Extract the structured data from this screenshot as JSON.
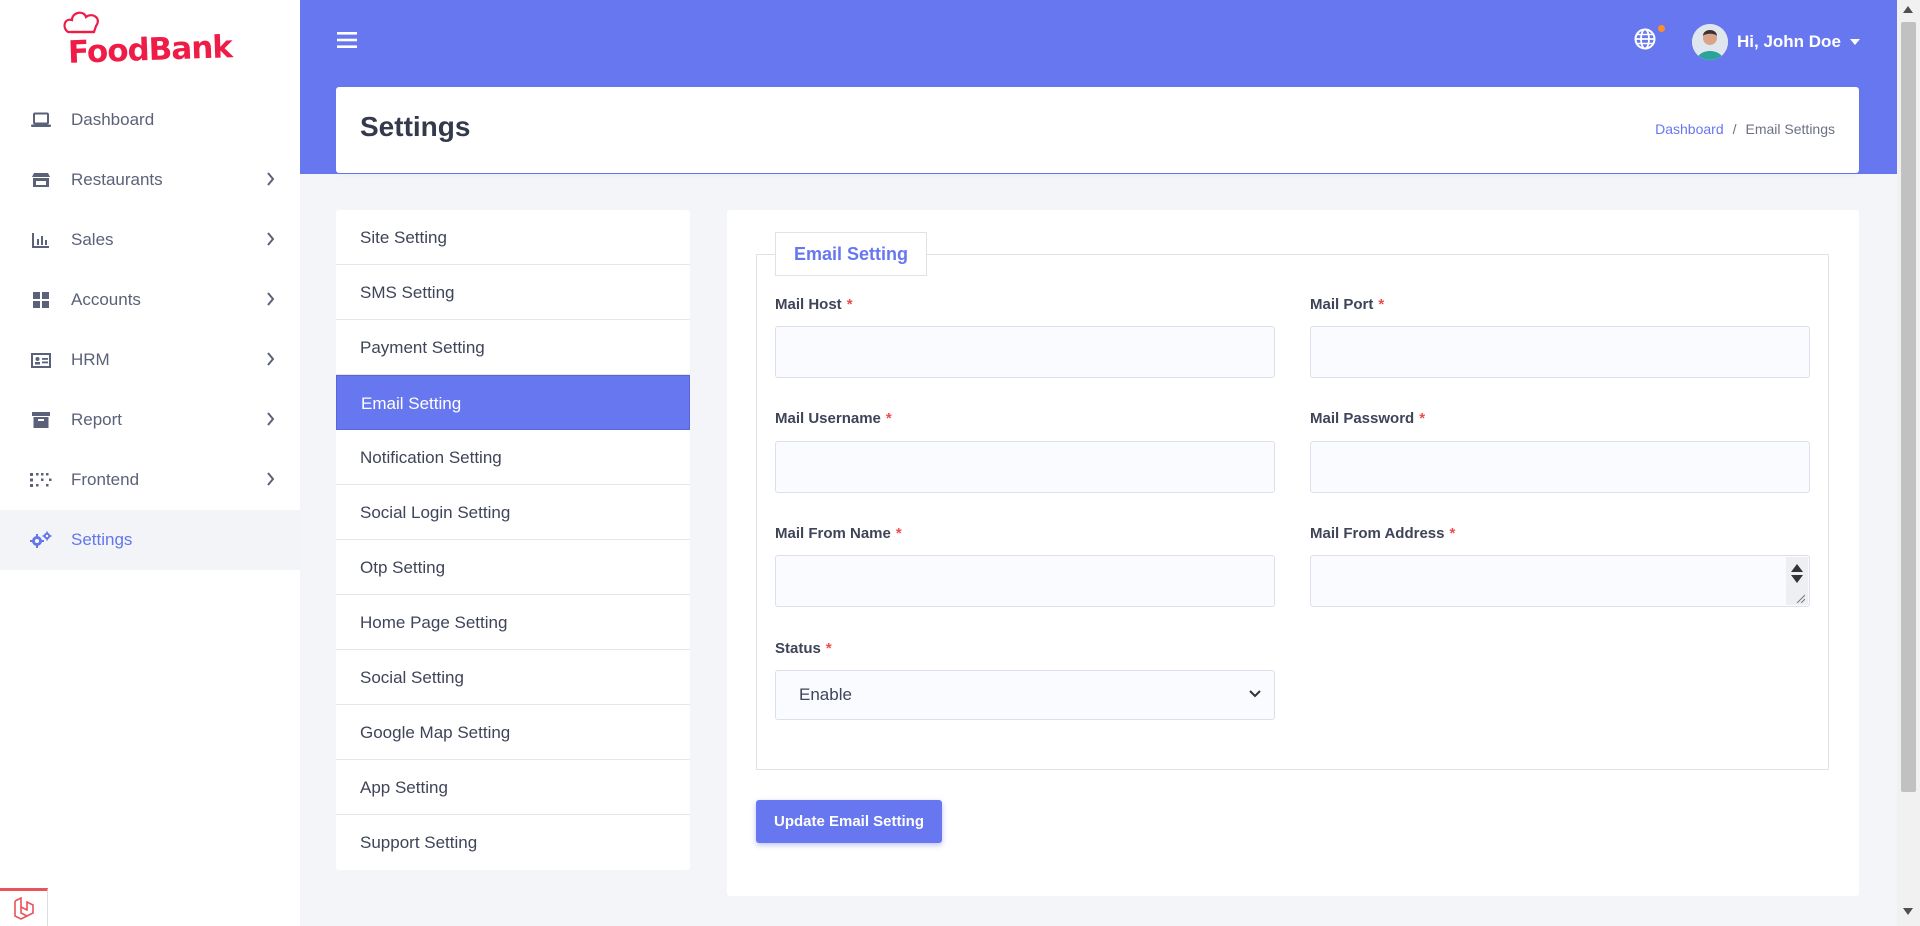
{
  "brand": {
    "name": "FoodBank",
    "color": "#ee1c47"
  },
  "sidebar": {
    "items": [
      {
        "label": "Dashboard",
        "icon": "laptop-icon",
        "has_submenu": false
      },
      {
        "label": "Restaurants",
        "icon": "store-icon",
        "has_submenu": true
      },
      {
        "label": "Sales",
        "icon": "bar-chart-icon",
        "has_submenu": true
      },
      {
        "label": "Accounts",
        "icon": "grid-icon",
        "has_submenu": true
      },
      {
        "label": "HRM",
        "icon": "id-card-icon",
        "has_submenu": true
      },
      {
        "label": "Report",
        "icon": "archive-icon",
        "has_submenu": true
      },
      {
        "label": "Frontend",
        "icon": "dots-grid-icon",
        "has_submenu": true
      },
      {
        "label": "Settings",
        "icon": "cogs-icon",
        "has_submenu": false,
        "active": true
      }
    ]
  },
  "header": {
    "user_greeting": "Hi, John Doe",
    "accent_color": "#6777ef"
  },
  "page": {
    "title": "Settings",
    "breadcrumb": [
      "Dashboard",
      "Email Settings"
    ]
  },
  "settings_menu": {
    "items": [
      "Site Setting",
      "SMS Setting",
      "Payment Setting",
      "Email Setting",
      "Notification Setting",
      "Social Login Setting",
      "Otp Setting",
      "Home Page Setting",
      "Social Setting",
      "Google Map Setting",
      "App Setting",
      "Support Setting"
    ],
    "active": "Email Setting"
  },
  "form": {
    "legend": "Email Setting",
    "fields": {
      "mail_host": {
        "label": "Mail Host",
        "value": ""
      },
      "mail_port": {
        "label": "Mail Port",
        "value": ""
      },
      "mail_username": {
        "label": "Mail Username",
        "value": ""
      },
      "mail_password": {
        "label": "Mail Password",
        "value": ""
      },
      "mail_from_name": {
        "label": "Mail From Name",
        "value": ""
      },
      "mail_from_address": {
        "label": "Mail From Address",
        "value": ""
      },
      "status": {
        "label": "Status",
        "value": "Enable"
      }
    },
    "required_mark": "*",
    "submit_label": "Update Email Setting"
  }
}
